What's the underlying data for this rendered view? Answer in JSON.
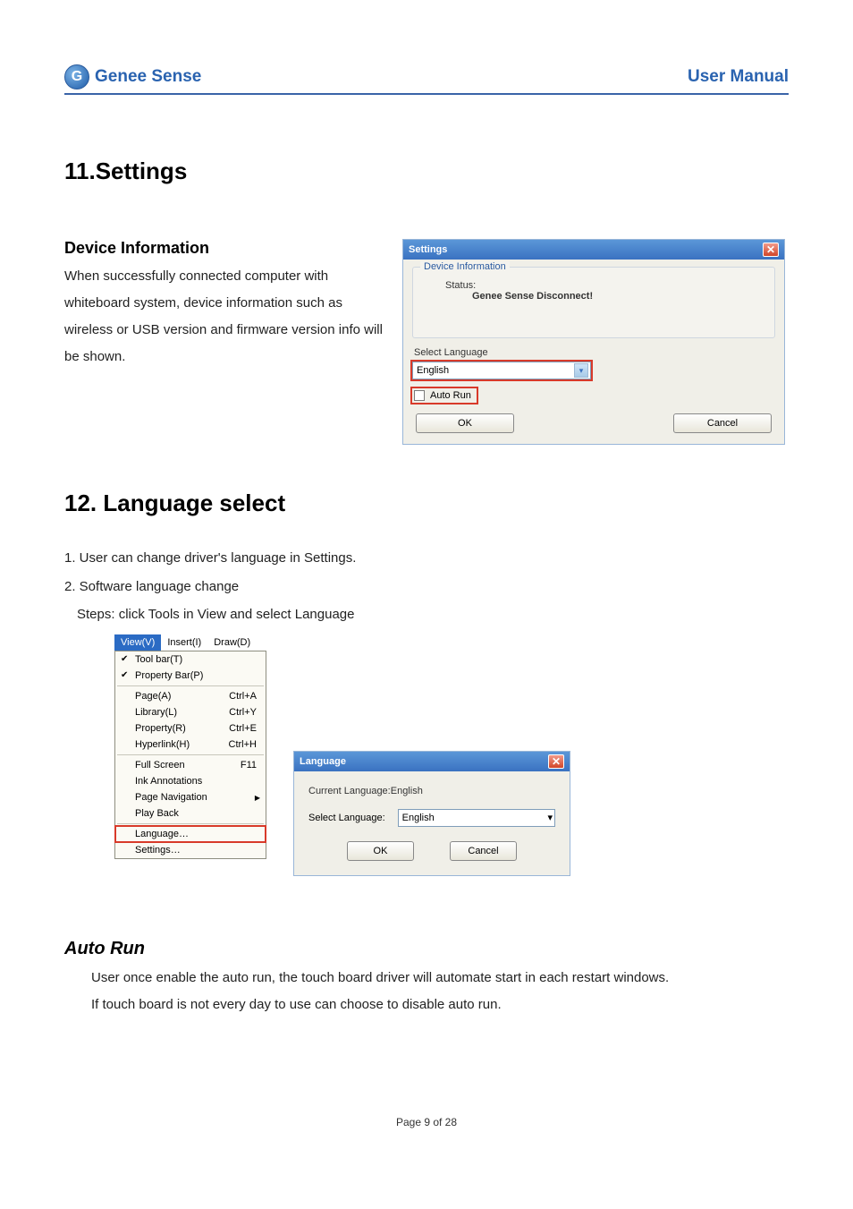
{
  "header": {
    "brand_initial": "G",
    "brand_name": "Genee Sense",
    "doc_type": "User Manual"
  },
  "section11": {
    "heading": "11.Settings",
    "sub_heading": "Device Information",
    "paragraph": "When successfully connected computer with whiteboard system, device information such as wireless or USB version and firmware version info will be shown."
  },
  "settings_dialog": {
    "title": "Settings",
    "group1_title": "Device Information",
    "status_label": "Status:",
    "status_value": "Genee Sense Disconnect!",
    "select_lang_label": "Select Language",
    "lang_value": "English",
    "autorun_label": "Auto Run",
    "ok": "OK",
    "cancel": "Cancel"
  },
  "section12": {
    "heading": "12. Language select",
    "line1": "1. User can change driver's language in Settings.",
    "line2": "2. Software language change",
    "line3": "Steps: click Tools in View and select Language"
  },
  "menu": {
    "bar": {
      "view": "View(V)",
      "insert": "Insert(I)",
      "draw": "Draw(D)"
    },
    "items": [
      {
        "label": "Tool bar(T)",
        "check": true
      },
      {
        "label": "Property Bar(P)",
        "check": true
      },
      {
        "label": "Page(A)",
        "shortcut": "Ctrl+A"
      },
      {
        "label": "Library(L)",
        "shortcut": "Ctrl+Y"
      },
      {
        "label": "Property(R)",
        "shortcut": "Ctrl+E"
      },
      {
        "label": "Hyperlink(H)",
        "shortcut": "Ctrl+H"
      },
      {
        "label": "Full Screen",
        "shortcut": "F11"
      },
      {
        "label": "Ink Annotations"
      },
      {
        "label": "Page Navigation",
        "sub": true
      },
      {
        "label": "Play Back"
      },
      {
        "label": "Language…",
        "hl": true
      },
      {
        "label": "Settings…"
      }
    ]
  },
  "lang_dialog": {
    "title": "Language",
    "current_label": "Current Language:English",
    "select_label": "Select Language:",
    "value": "English",
    "ok": "OK",
    "cancel": "Cancel"
  },
  "autorun": {
    "heading": "Auto Run",
    "p1": "User once enable the auto run, the touch board driver will automate start in each restart windows.",
    "p2": "If touch board is not every day to use can choose to disable auto run."
  },
  "footer": "Page 9 of 28"
}
